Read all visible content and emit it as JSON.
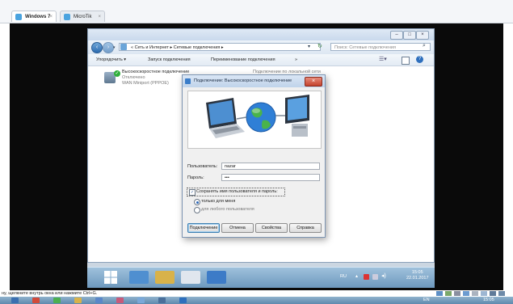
{
  "host_tabs": [
    {
      "label": "Windows 7",
      "close": "×"
    },
    {
      "label": "MicroTik",
      "close": "×"
    }
  ],
  "explorer": {
    "window_buttons": [
      "–",
      "□",
      "×"
    ],
    "address_path": "« Сеть и Интернет ▸ Сетевые подключения ▸",
    "search_placeholder": "Поиск: Сетевые подключения",
    "toolbar": {
      "organize": "Упорядочить ▾",
      "start_connection": "Запуск подключения",
      "rename": "Переименование подключения",
      "more": "»"
    },
    "connection": {
      "name": "Высокоскоростное подключение",
      "status": "Отключено",
      "device": "WAN Miniport (PPPOE)"
    },
    "obscured_text": "Подключение по локальной сети"
  },
  "dialog": {
    "title": "Подключение: Высокоскоростное подключение",
    "close": "×",
    "username_label": "Пользователь:",
    "username_value": "nazar",
    "password_label": "Пароль:",
    "password_value": "•••",
    "save_checkbox_label": "Сохранять имя пользователя и пароль:",
    "save_checkbox_checked": true,
    "radio_me_only": "только для меня",
    "radio_anyone": "для любого пользователя",
    "buttons": {
      "connect": "Подключение",
      "cancel": "Отмена",
      "properties": "Свойства",
      "help": "Справка"
    }
  },
  "guest_taskbar": {
    "language": "RU",
    "time": "15:05",
    "date": "22.01.2017"
  },
  "host_status_text": "ну, щелкните внутрь окна или нажмите Ctrl+G.",
  "host_taskbar": {
    "language": "EN",
    "time": "15:05"
  },
  "colors": {
    "vm_background": "#0a0a0a",
    "taskbar": "#6d98bd",
    "dialog_close": "#c4432d",
    "connected_check": "#2fae3b"
  }
}
